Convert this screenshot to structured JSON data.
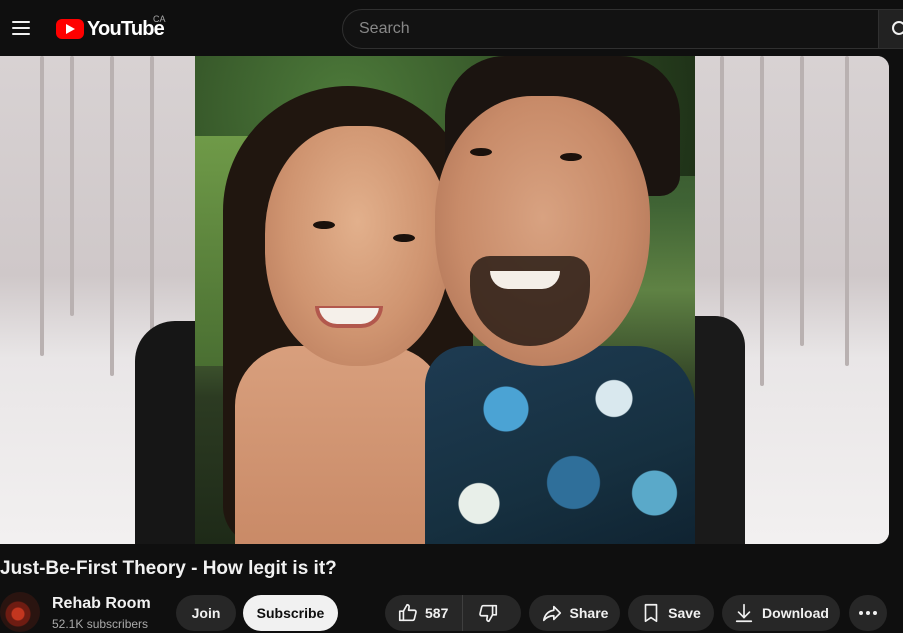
{
  "header": {
    "logo_text": "YouTube",
    "country_code": "CA",
    "search_placeholder": "Search"
  },
  "video": {
    "title": "Just-Be-First Theory - How legit is it?"
  },
  "channel": {
    "name": "Rehab Room",
    "subscribers": "52.1K subscribers"
  },
  "actions": {
    "join_label": "Join",
    "subscribe_label": "Subscribe",
    "like_count": "587",
    "share_label": "Share",
    "save_label": "Save",
    "download_label": "Download"
  },
  "colors": {
    "background": "#0f0f0f",
    "brand_red": "#ff0000",
    "pill_bg": "#272727",
    "subscribe_bg": "#f1f1f1"
  }
}
